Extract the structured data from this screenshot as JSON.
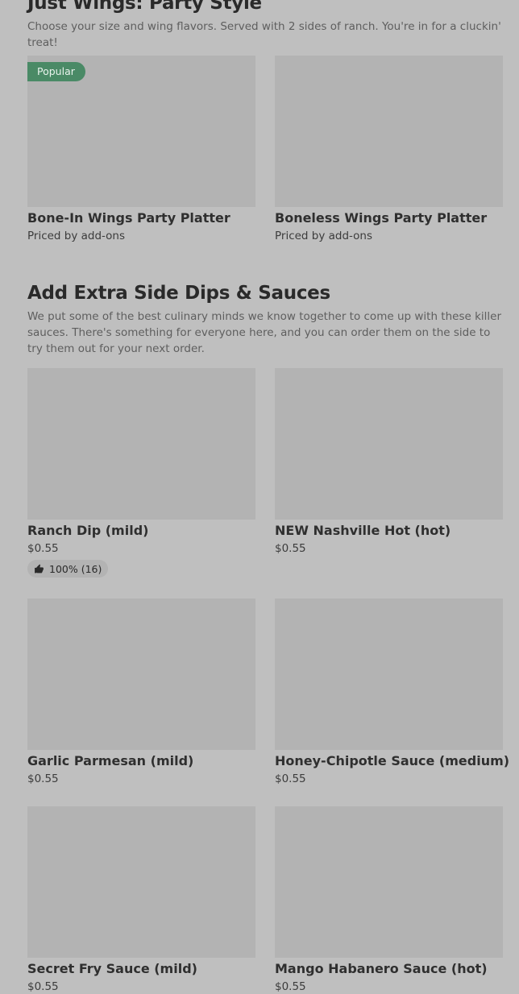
{
  "sections": [
    {
      "title": "Just Wings: Party Style",
      "description": "Choose your size and wing flavors. Served with 2 sides of ranch. You're in for a cluckin' treat!",
      "items": [
        {
          "name": "Bone-In Wings Party Platter",
          "price": "Priced by add-ons",
          "badge": "Popular"
        },
        {
          "name": "Boneless Wings Party Platter",
          "price": "Priced by add-ons"
        }
      ]
    },
    {
      "title": "Add Extra Side Dips & Sauces",
      "description": "We put some of the best culinary minds we know together to come up with these killer sauces. There's something for everyone here, and you can order them on the side to try them out for your next order.",
      "items": [
        {
          "name": "Ranch Dip (mild)",
          "price": "$0.55",
          "rating": "100% (16)"
        },
        {
          "name": "NEW Nashville Hot (hot)",
          "price": "$0.55"
        },
        {
          "name": "Garlic Parmesan (mild)",
          "price": "$0.55"
        },
        {
          "name": "Honey-Chipotle Sauce (medium)",
          "price": "$0.55"
        },
        {
          "name": "Secret Fry Sauce (mild)",
          "price": "$0.55"
        },
        {
          "name": "Mango Habanero Sauce (hot)",
          "price": "$0.55"
        }
      ]
    }
  ],
  "icons": {
    "rating": "thumbs-up-icon"
  },
  "colors": {
    "badge": "#4a8a66",
    "background": "#bfbfbf",
    "placeholder": "#b3b3b3"
  }
}
